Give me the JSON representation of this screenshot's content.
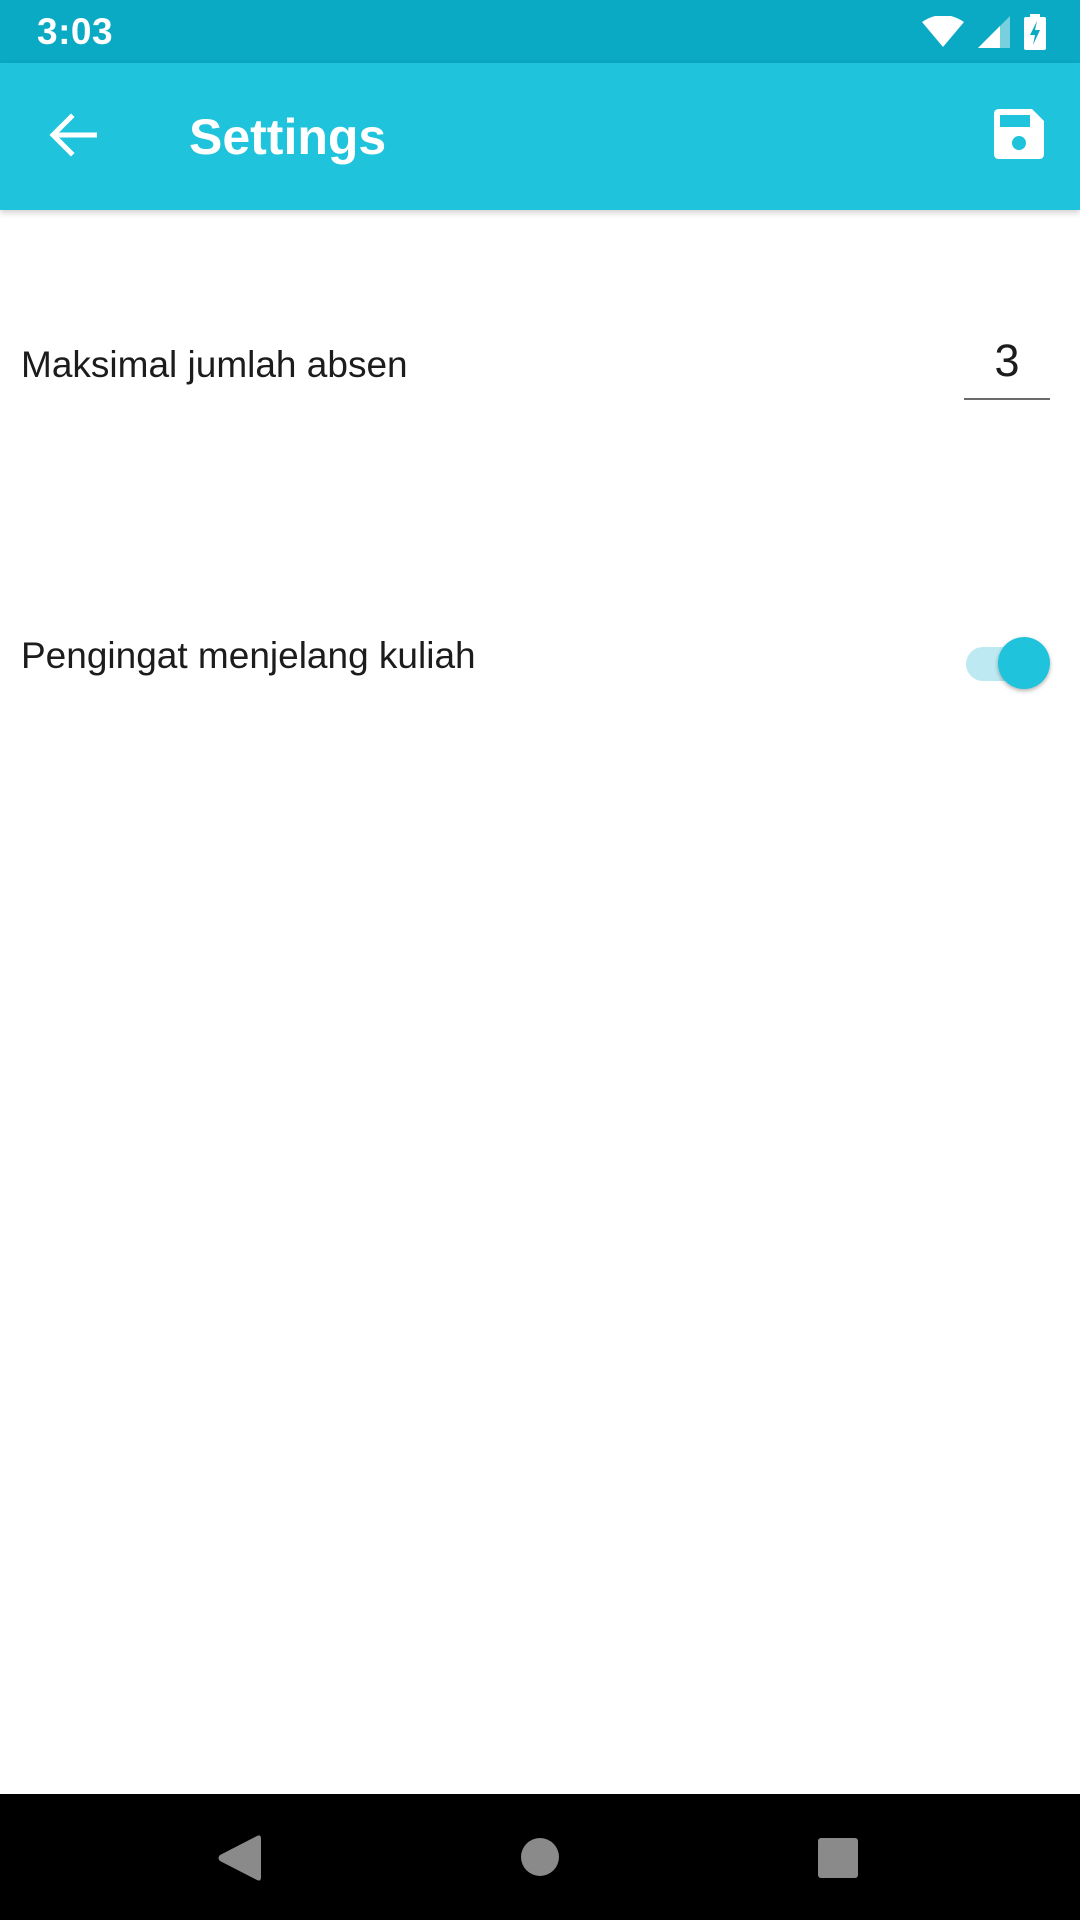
{
  "status_bar": {
    "time": "3:03",
    "icons": [
      "wifi-icon",
      "cell-signal-icon",
      "battery-charging-icon"
    ]
  },
  "app_bar": {
    "title": "Settings",
    "back_icon": "arrow-back-icon",
    "save_icon": "floppy-disk-save-icon",
    "background_color": "#1FC3DC",
    "status_bar_color": "#0AA9C4"
  },
  "settings": {
    "max_absences": {
      "label": "Maksimal jumlah absen",
      "value": "3"
    },
    "class_reminder": {
      "label": "Pengingat menjelang kuliah",
      "enabled": true
    }
  },
  "nav_bar": {
    "icons": [
      "nav-back-icon",
      "nav-home-icon",
      "nav-recents-icon"
    ]
  }
}
